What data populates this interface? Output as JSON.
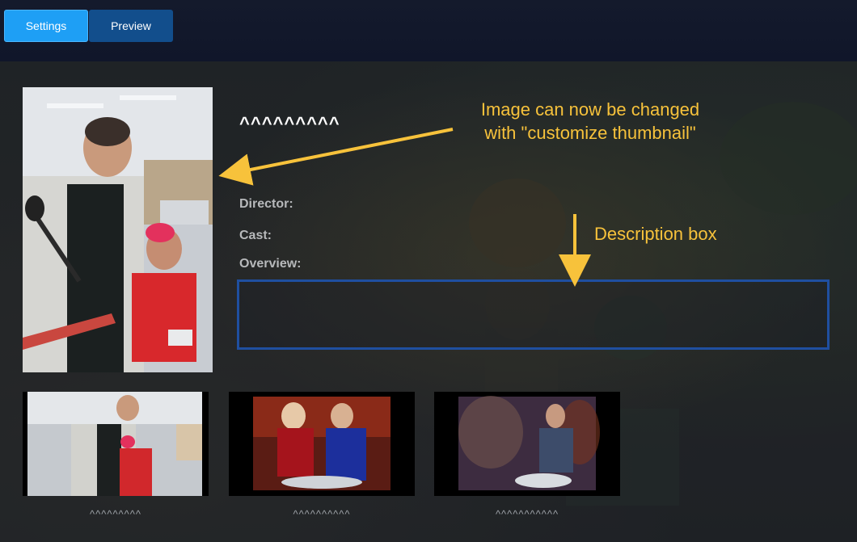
{
  "tabs": {
    "settings_label": "Settings",
    "preview_label": "Preview"
  },
  "item": {
    "title": "^^^^^^^^^",
    "director_label": "Director:",
    "cast_label": "Cast:",
    "overview_label": "Overview:"
  },
  "annotations": {
    "image_note": "Image can now be changed\nwith \"customize thumbnail\"",
    "description_note": "Description box"
  },
  "thumbnails": [
    {
      "caption": "^^^^^^^^^"
    },
    {
      "caption": "^^^^^^^^^^"
    },
    {
      "caption": "^^^^^^^^^^^"
    }
  ],
  "colors": {
    "accent": "#1e9ff5",
    "tab_inactive": "#124e8c",
    "annotation": "#f7c23b",
    "description_border": "#1f4fa0"
  }
}
